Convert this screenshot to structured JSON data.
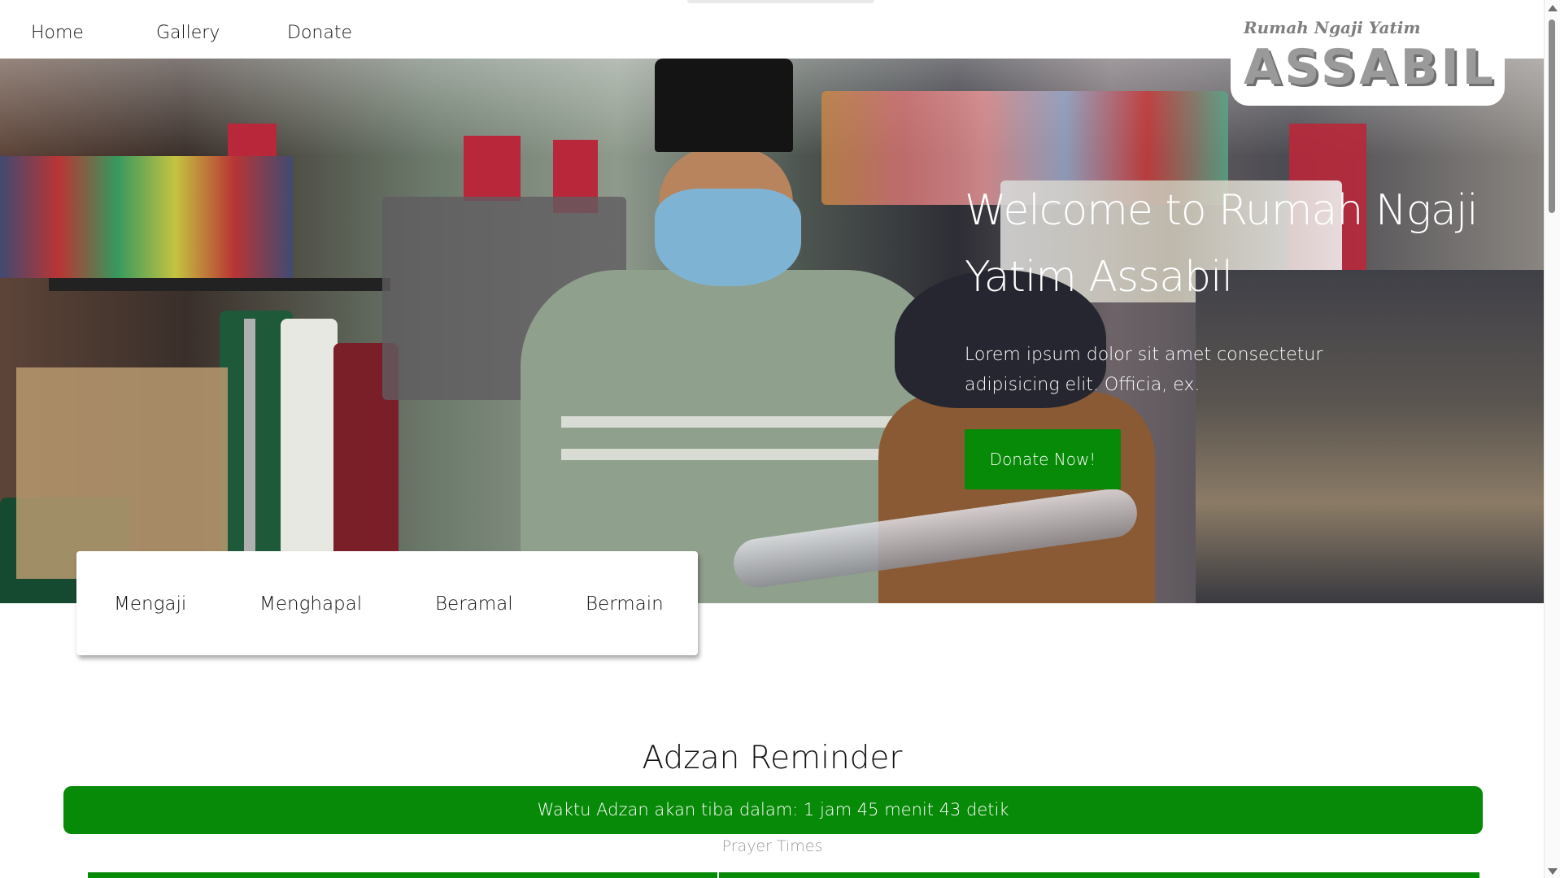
{
  "nav": {
    "home": "Home",
    "gallery": "Gallery",
    "donate": "Donate"
  },
  "logo": {
    "subtitle": "Rumah Ngaji Yatim",
    "name": "ASSABIL"
  },
  "hero": {
    "title": "Welcome to Rumah Ngaji Yatim Assabil",
    "text": "Lorem ipsum dolor sit amet consectetur adipisicing elit. Officia, ex.",
    "donate_button": "Donate Now!"
  },
  "features": [
    "Mengaji",
    "Menghapal",
    "Beramal",
    "Bermain"
  ],
  "adzan": {
    "title": "Adzan Reminder",
    "countdown": "Waktu Adzan akan tiba dalam: 1 jam 45 menit 43 detik",
    "prayer_times_label": "Prayer Times"
  },
  "colors": {
    "accent": "#078a07",
    "nav_bg": "#ffffff"
  }
}
